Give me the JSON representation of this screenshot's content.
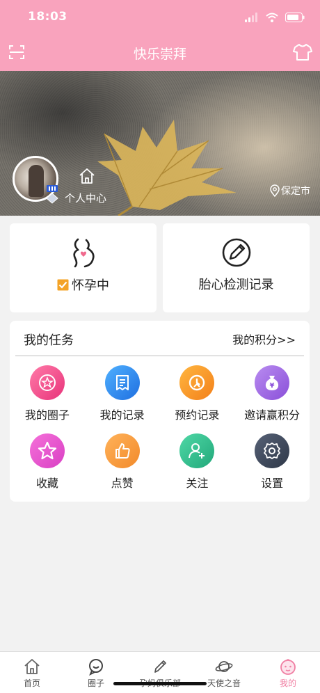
{
  "status_bar": {
    "time": "18:03"
  },
  "nav": {
    "title": "快乐崇拜"
  },
  "banner": {
    "personal_center": "个人中心",
    "location": "保定市"
  },
  "cards": {
    "pregnancy": {
      "label": "怀孕中"
    },
    "fetal_heart": {
      "label": "胎心检测记录"
    }
  },
  "tasks": {
    "title": "我的任务",
    "points_link": "我的积分>>",
    "items": [
      {
        "label": "我的圈子",
        "icon": "star-circle-icon",
        "color": "#f0508f"
      },
      {
        "label": "我的记录",
        "icon": "document-icon",
        "color": "#2f8bf0"
      },
      {
        "label": "预约记录",
        "icon": "appointment-icon",
        "color": "#f7931e"
      },
      {
        "label": "邀请赢积分",
        "icon": "money-bag-icon",
        "color": "#9b5de5"
      },
      {
        "label": "收藏",
        "icon": "star-icon",
        "color": "#e84bd0"
      },
      {
        "label": "点赞",
        "icon": "thumbs-up-icon",
        "color": "#f7962a"
      },
      {
        "label": "关注",
        "icon": "add-user-icon",
        "color": "#2ebf8f"
      },
      {
        "label": "设置",
        "icon": "gear-icon",
        "color": "#3a4456"
      }
    ]
  },
  "tabbar": {
    "items": [
      {
        "label": "首页",
        "icon": "home-icon"
      },
      {
        "label": "圈子",
        "icon": "chat-icon"
      },
      {
        "label": "孕妈俱乐部",
        "icon": "pen-icon"
      },
      {
        "label": "天使之音",
        "icon": "planet-icon"
      },
      {
        "label": "我的",
        "icon": "baby-face-icon"
      }
    ],
    "active": "我的"
  }
}
